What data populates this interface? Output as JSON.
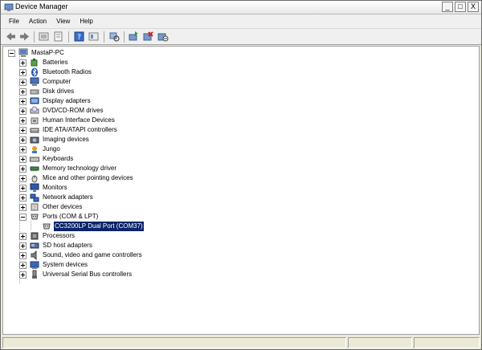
{
  "window": {
    "title": "Device Manager",
    "controls": {
      "minimize": "_",
      "restore": "□",
      "close": "X"
    }
  },
  "menu": [
    "File",
    "Action",
    "View",
    "Help"
  ],
  "toolbar": {
    "buttons": [
      "back-icon",
      "forward-icon",
      "up-icon",
      "properties-icon",
      "help-icon",
      "show-hide-icon",
      "scan-hardware-icon",
      "update-driver-icon",
      "uninstall-icon",
      "disable-icon"
    ]
  },
  "tree": {
    "root": "MastaP-PC",
    "categories": [
      {
        "label": "Batteries",
        "icon": "battery-icon"
      },
      {
        "label": "Bluetooth Radios",
        "icon": "bluetooth-icon"
      },
      {
        "label": "Computer",
        "icon": "computer-icon"
      },
      {
        "label": "Disk drives",
        "icon": "disk-icon"
      },
      {
        "label": "Display adapters",
        "icon": "display-icon"
      },
      {
        "label": "DVD/CD-ROM drives",
        "icon": "dvd-icon"
      },
      {
        "label": "Human Interface Devices",
        "icon": "hid-icon"
      },
      {
        "label": "IDE ATA/ATAPI controllers",
        "icon": "ide-icon"
      },
      {
        "label": "Imaging devices",
        "icon": "camera-icon"
      },
      {
        "label": "Jungo",
        "icon": "jungo-icon"
      },
      {
        "label": "Keyboards",
        "icon": "keyboard-icon"
      },
      {
        "label": "Memory technology driver",
        "icon": "memory-icon"
      },
      {
        "label": "Mice and other pointing devices",
        "icon": "mouse-icon"
      },
      {
        "label": "Monitors",
        "icon": "monitor-icon"
      },
      {
        "label": "Network adapters",
        "icon": "network-icon"
      },
      {
        "label": "Other devices",
        "icon": "other-devices-icon"
      },
      {
        "label": "Ports (COM & LPT)",
        "icon": "port-icon",
        "expanded": true
      },
      {
        "label": "Processors",
        "icon": "processor-icon"
      },
      {
        "label": "SD host adapters",
        "icon": "sd-icon"
      },
      {
        "label": "Sound, video and game controllers",
        "icon": "sound-icon"
      },
      {
        "label": "System devices",
        "icon": "system-icon"
      },
      {
        "label": "Universal Serial Bus controllers",
        "icon": "usb-icon"
      }
    ],
    "selected_child": {
      "label": "CC3200LP Dual Port (COM37)",
      "icon": "port-device-icon"
    }
  },
  "colors": {
    "selection": "#0a246a",
    "pane_bg": "#ffffff",
    "chrome": "#f0f0f0"
  }
}
